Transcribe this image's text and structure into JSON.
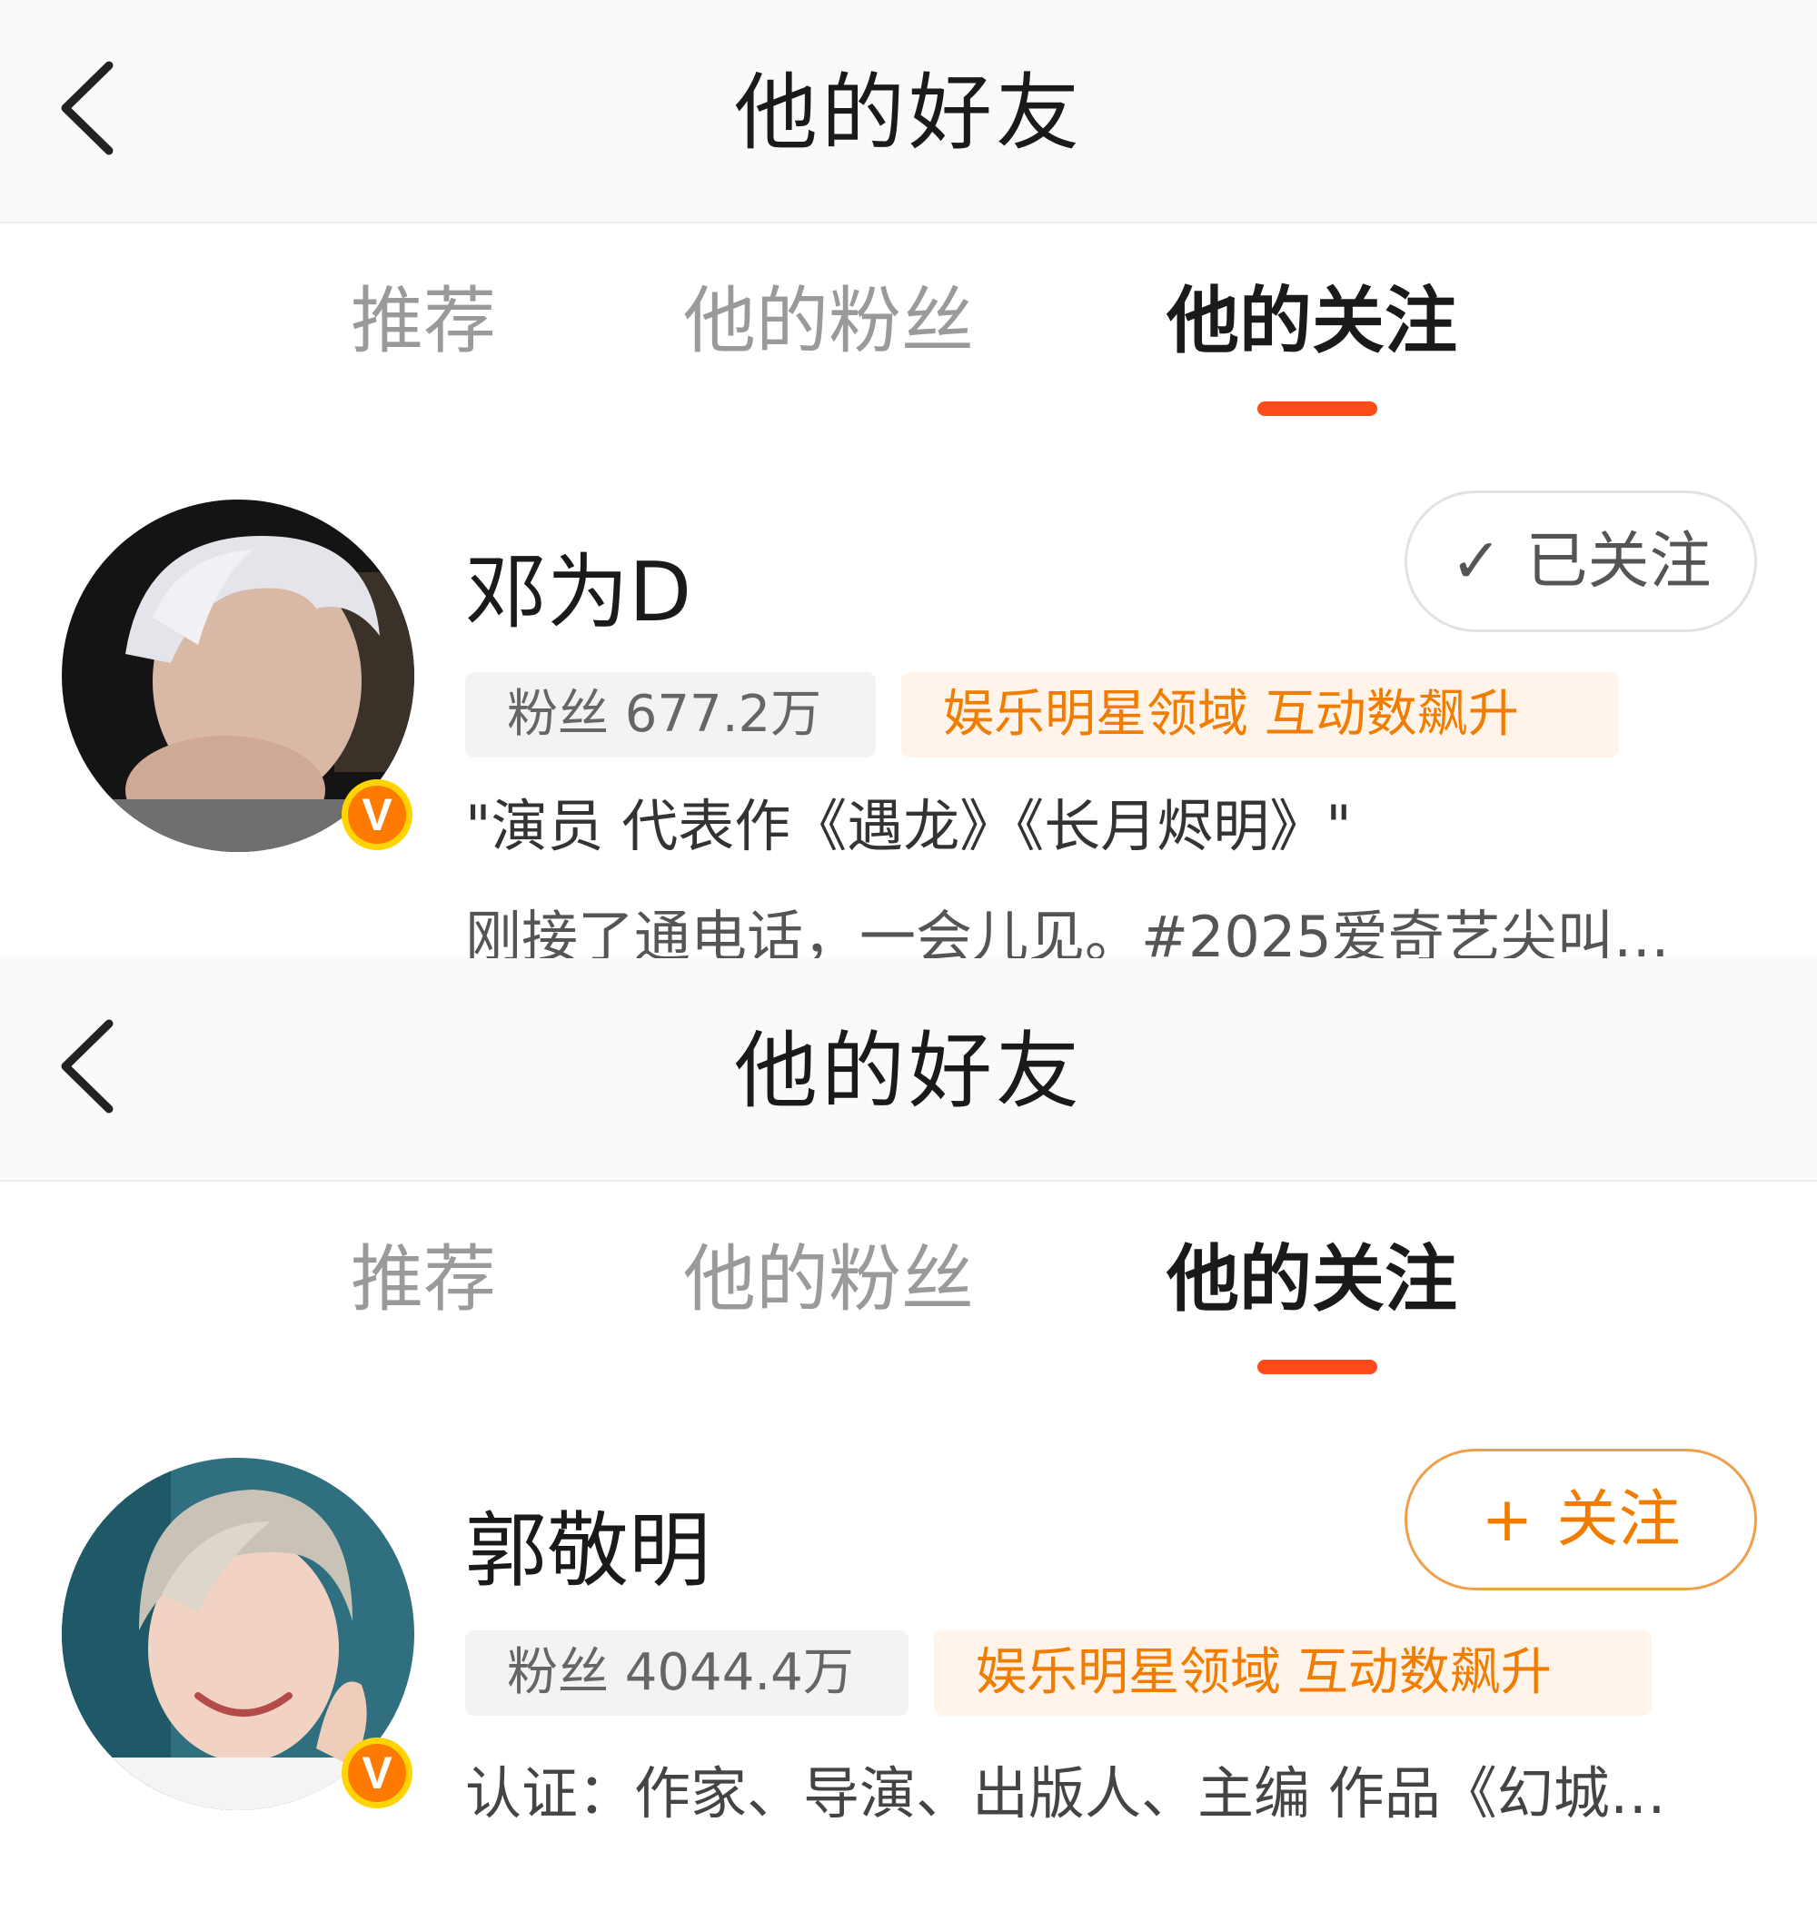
{
  "colors": {
    "accent": "#ff4a1c",
    "follow_orange": "#f07d00",
    "tag_bg": "#fff3ea",
    "verified_badge": "#ff7a00"
  },
  "panels": [
    {
      "header": {
        "back_icon": "chevron-left-icon",
        "title": "他的好友"
      },
      "tabs": [
        {
          "label": "推荐",
          "active": false
        },
        {
          "label": "他的粉丝",
          "active": false
        },
        {
          "label": "他的关注",
          "active": true
        }
      ],
      "user": {
        "name": "邓为D",
        "verified_icon": "V",
        "follow_button": {
          "icon": "✓",
          "label": "已关注",
          "state": "followed"
        },
        "fans_label": "粉丝 677.2万",
        "domain_tag": "娱乐明星领域 互动数飙升",
        "description": "\"演员 代表作《遇龙》《长月烬明》\"",
        "latest_post": "刚接了通电话，一会儿见。#2025爱奇艺尖叫…"
      }
    },
    {
      "header": {
        "back_icon": "chevron-left-icon",
        "title": "他的好友"
      },
      "tabs": [
        {
          "label": "推荐",
          "active": false
        },
        {
          "label": "他的粉丝",
          "active": false
        },
        {
          "label": "他的关注",
          "active": true
        }
      ],
      "user": {
        "name": "郭敬明",
        "verified_icon": "V",
        "follow_button": {
          "icon": "+",
          "label": "关注",
          "state": "unfollowed"
        },
        "fans_label": "粉丝 4044.4万",
        "domain_tag": "娱乐明星领域 互动数飙升",
        "description": "认证：作家、导演、出版人、主编 作品《幻城…"
      }
    }
  ]
}
